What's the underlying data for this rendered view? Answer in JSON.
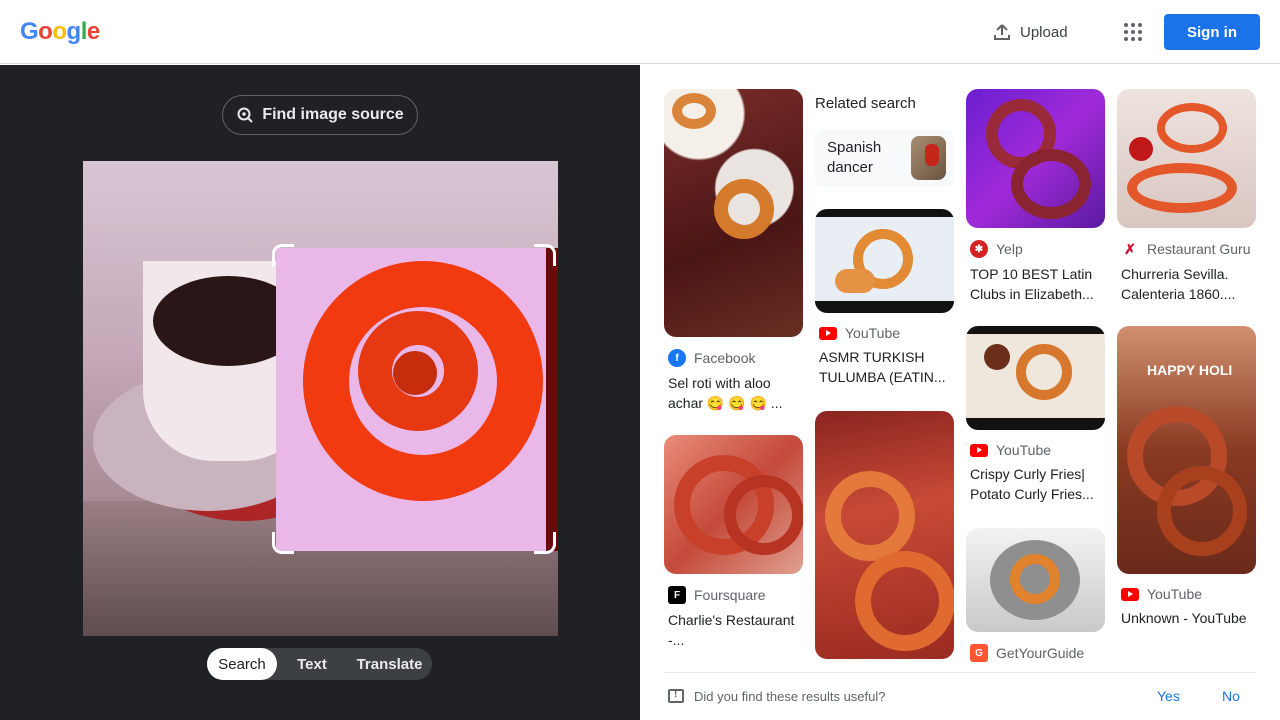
{
  "header": {
    "logo": "Google",
    "upload_label": "Upload",
    "signin_label": "Sign in"
  },
  "left": {
    "find_source_label": "Find image source",
    "modes": [
      "Search",
      "Text",
      "Translate"
    ],
    "active_mode": "Search"
  },
  "related": {
    "heading": "Related search",
    "chip_label": "Spanish dancer"
  },
  "results": [
    {
      "source": "Facebook",
      "title": "Sel roti with aloo achar 😋 😋 😋 ..."
    },
    {
      "source": "YouTube",
      "title": "ASMR TURKISH TULUMBA (EATIN..."
    },
    {
      "source": "Yelp",
      "title": "TOP 10 BEST Latin Clubs in Elizabeth..."
    },
    {
      "source": "Restaurant Guru",
      "title": "Churreria Sevilla. Calenteria 1860...."
    },
    {
      "source": "YouTube",
      "title": "Crispy Curly Fries| Potato Curly Fries..."
    },
    {
      "source": "Foursquare",
      "title": "Charlie's Restaurant -..."
    },
    {
      "source": "GetYourGuide",
      "title": ""
    },
    {
      "source": "YouTube",
      "title": "Unknown - YouTube"
    }
  ],
  "overlay_text": "HAPPY HOLI",
  "feedback": {
    "question": "Did you find these results useful?",
    "yes": "Yes",
    "no": "No"
  },
  "colors": {
    "brand_blue": "#1a73e8",
    "left_panel_bg": "#202124"
  }
}
